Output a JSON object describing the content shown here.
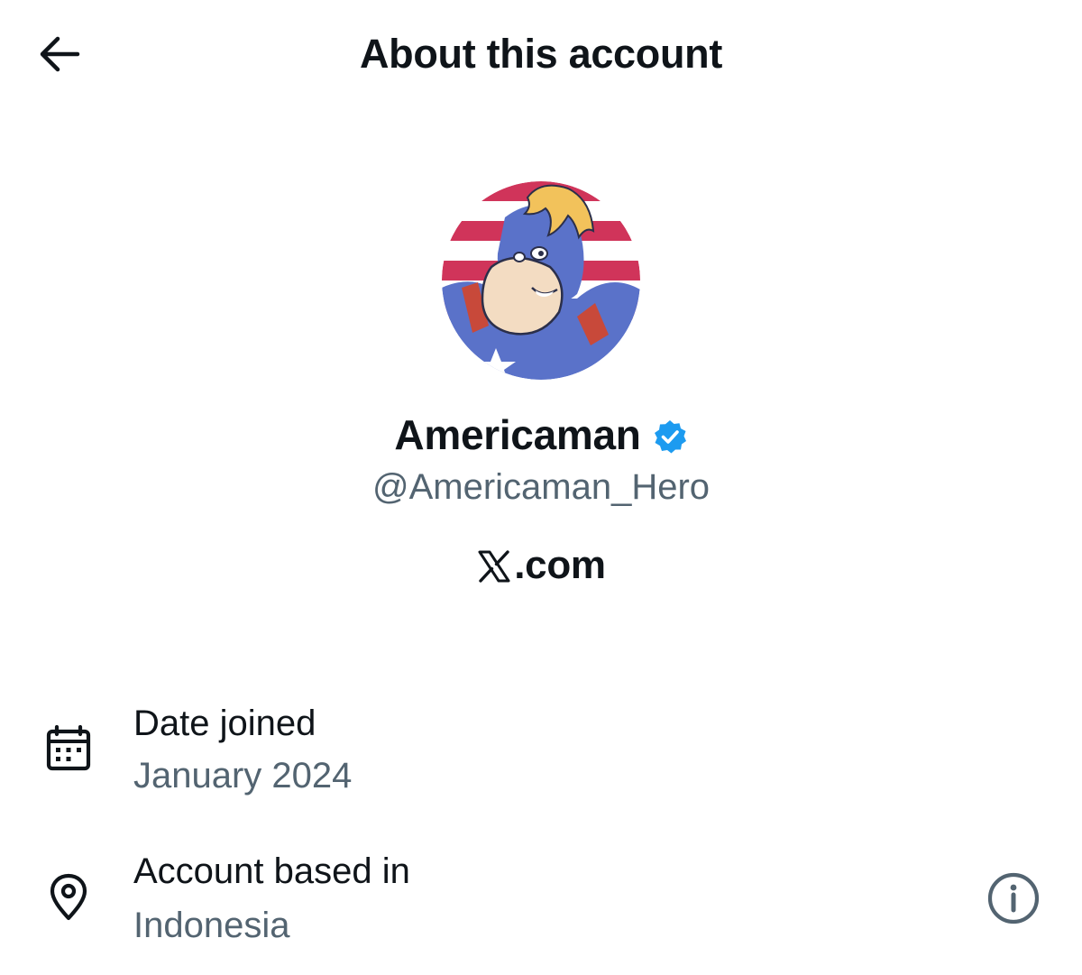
{
  "header": {
    "title": "About this account",
    "back_icon": "arrow-left-icon"
  },
  "profile": {
    "display_name": "Americaman",
    "handle": "@Americaman_Hero",
    "verified": true,
    "verified_icon": "verified-badge-icon",
    "verified_color": "#1d9bf0",
    "platform_domain": ".com",
    "platform_logo": "x-logo-icon",
    "avatar_description": "cartoon superhero in blue mask on red and white striped background"
  },
  "details": [
    {
      "label": "Date joined",
      "value": "January 2024",
      "icon": "calendar-icon"
    },
    {
      "label": "Account based in",
      "value": "Indonesia",
      "icon": "location-pin-icon",
      "action_icon": "info-icon"
    }
  ],
  "colors": {
    "text_primary": "#0f1419",
    "text_secondary": "#536471",
    "accent": "#1d9bf0",
    "flag_red": "#d0345a",
    "hero_blue": "#5a72c9"
  }
}
